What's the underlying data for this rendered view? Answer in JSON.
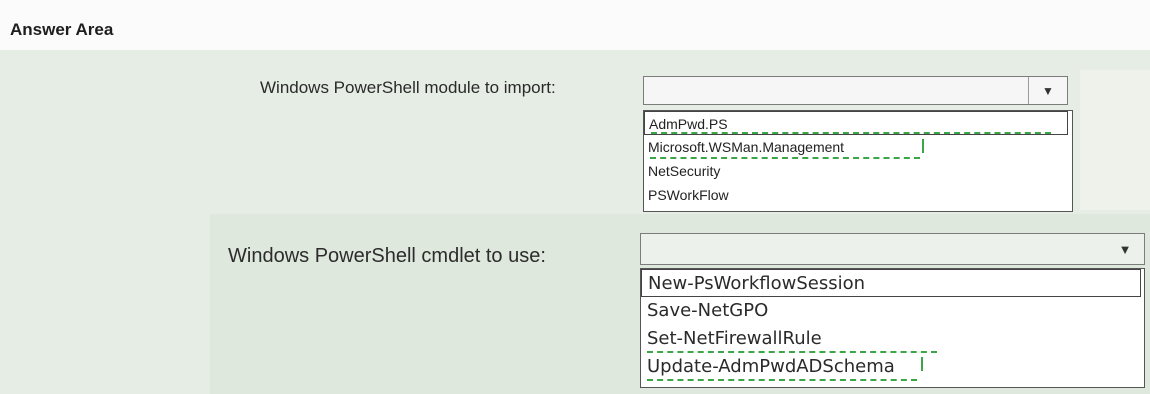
{
  "answer_area": {
    "title": "Answer Area"
  },
  "question1": {
    "label": "Windows PowerShell module to import:",
    "selected_value": "",
    "dropdown_arrow": "chevron-down-icon",
    "options": [
      "AdmPwd.PS",
      "Microsoft.WSMan.Management",
      "NetSecurity",
      "PSWorkFlow"
    ]
  },
  "question2": {
    "label": "Windows PowerShell cmdlet to use:",
    "selected_value": "",
    "dropdown_arrow": "chevron-down-icon",
    "options": [
      "New-PsWorkflowSession",
      "Save-NetGPO",
      "Set-NetFirewallRule",
      "Update-AdmPwdADSchema"
    ]
  },
  "colors": {
    "background": "#fbfbfb",
    "panel": "#e6ede4",
    "answer_dash": "#3aa646"
  }
}
